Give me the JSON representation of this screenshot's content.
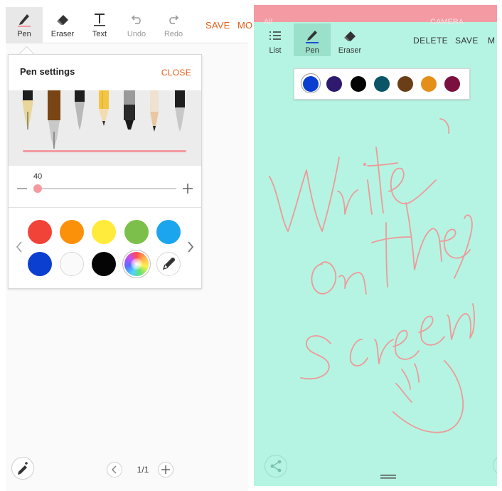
{
  "left": {
    "toolbar": {
      "tools": [
        {
          "label": "Pen",
          "icon": "pen-icon"
        },
        {
          "label": "Eraser",
          "icon": "eraser-icon"
        },
        {
          "label": "Text",
          "icon": "text-icon"
        },
        {
          "label": "Undo",
          "icon": "undo-icon"
        },
        {
          "label": "Redo",
          "icon": "redo-icon"
        }
      ],
      "save_label": "SAVE",
      "more_label": "MO"
    },
    "pen_settings": {
      "title": "Pen settings",
      "close_label": "CLOSE",
      "pens": [
        "fountain-pen",
        "calligraphy-pen",
        "ballpoint-pen",
        "pencil",
        "marker",
        "brush-pen",
        "fine-pen"
      ],
      "stroke_color": "#f29aa0",
      "size_value": "40",
      "colors": [
        "#f14338",
        "#fb9109",
        "#ffeb3b",
        "#7cc04a",
        "#1aa5ee",
        "#0a3fcf",
        "#fafafa",
        "#050505"
      ],
      "special_swatches": [
        "color-spectrum-icon",
        "eyedropper-icon"
      ]
    },
    "pager": {
      "page": "1/1"
    }
  },
  "right": {
    "top_strip": {
      "left_text": "All",
      "right_text": "CAMERA"
    },
    "toolbar": {
      "tools": [
        {
          "label": "List",
          "icon": "list-icon"
        },
        {
          "label": "Pen",
          "icon": "pen-icon"
        },
        {
          "label": "Eraser",
          "icon": "eraser-icon"
        }
      ],
      "delete_label": "DELETE",
      "save_label": "SAVE",
      "more_label": "M"
    },
    "background_color": "#b5f4e2",
    "pen_colors": [
      "#0a3fcf",
      "#2d1a6e",
      "#050505",
      "#0a5566",
      "#6a3f18",
      "#e58f1b",
      "#7b1040"
    ],
    "ink_color": "#ee9a9a",
    "handwriting": "Write on the Screen"
  }
}
